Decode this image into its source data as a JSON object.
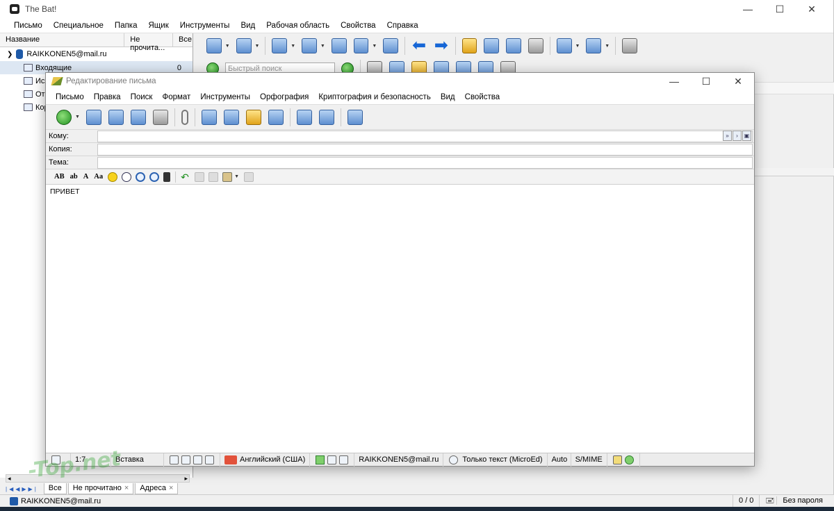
{
  "main": {
    "title": "The Bat!",
    "menu": [
      "Письмо",
      "Специальное",
      "Папка",
      "Ящик",
      "Инструменты",
      "Вид",
      "Рабочая область",
      "Свойства",
      "Справка"
    ],
    "folder_header": {
      "name": "Название",
      "unread": "Не прочита...",
      "all": "Все"
    },
    "account": "RAIKKONEN5@mail.ru",
    "folders": [
      {
        "label": "Входящие",
        "count": "0"
      },
      {
        "label": "Исх",
        "count": ""
      },
      {
        "label": "Отп",
        "count": ""
      },
      {
        "label": "Кор",
        "count": ""
      }
    ],
    "quick_search_placeholder": "Быстрый поиск",
    "left_tabs": [
      "Все",
      "Не прочитано",
      "Адреса"
    ],
    "status": {
      "account": "RAIKKONEN5@mail.ru",
      "counts": "0 / 0",
      "password": "Без пароля"
    }
  },
  "compose": {
    "title": "Редактирование письма",
    "menu": [
      "Письмо",
      "Правка",
      "Поиск",
      "Формат",
      "Инструменты",
      "Орфография",
      "Криптография и безопасность",
      "Вид",
      "Свойства"
    ],
    "fields": {
      "to_label": "Кому:",
      "cc_label": "Копия:",
      "subject_label": "Тема:",
      "to": "",
      "cc": "",
      "subject": ""
    },
    "format_bar": [
      "AB",
      "ab",
      "A",
      "Aa"
    ],
    "body": "ПРИВЕТ",
    "status": {
      "position": "1:7",
      "mode": "Вставка",
      "language": "Английский (США)",
      "account": "RAIKKONEN5@mail.ru",
      "editor": "Только текст (MicroEd)",
      "auto": "Auto",
      "smime": "S/MIME"
    }
  },
  "watermark": "-Top.net"
}
